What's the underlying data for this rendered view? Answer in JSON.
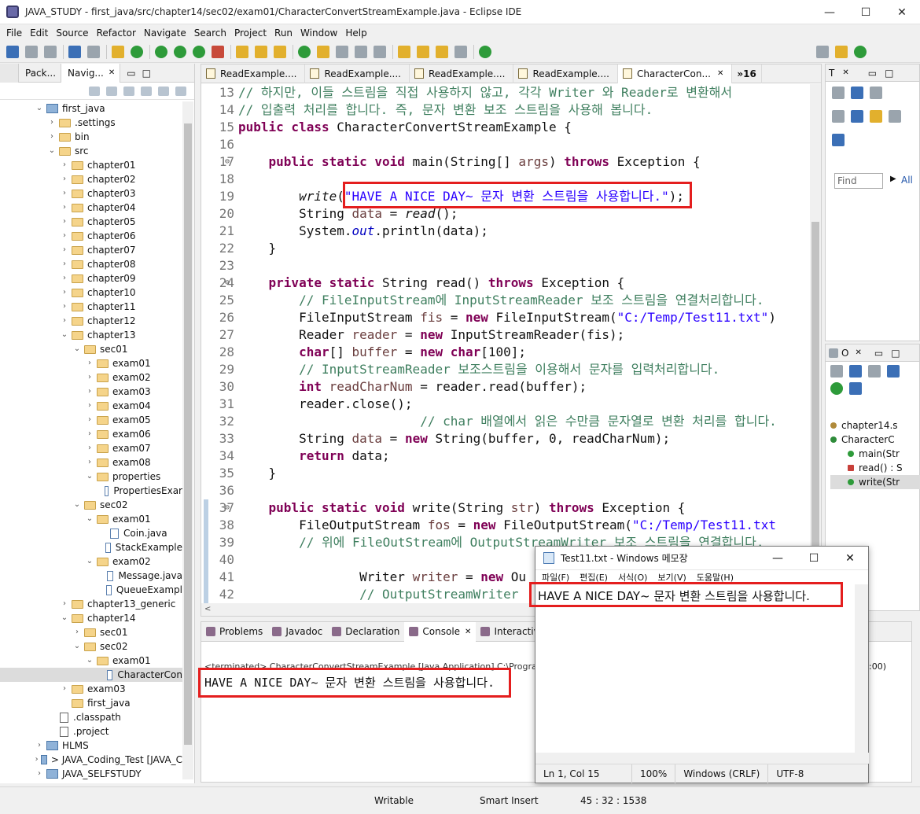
{
  "window": {
    "title": "JAVA_STUDY - first_java/src/chapter14/sec02/exam01/CharacterConvertStreamExample.java - Eclipse IDE",
    "minimize": "—",
    "maximize": "☐",
    "close": "✕"
  },
  "menu": [
    "File",
    "Edit",
    "Source",
    "Refactor",
    "Navigate",
    "Search",
    "Project",
    "Run",
    "Window",
    "Help"
  ],
  "left_panel": {
    "tabs": [
      "Pack...",
      "Navig..."
    ],
    "tree": [
      {
        "label": "first_java",
        "level": 0,
        "kind": "project",
        "open": true
      },
      {
        "label": ".settings",
        "level": 1,
        "kind": "folder",
        "open": false
      },
      {
        "label": "bin",
        "level": 1,
        "kind": "folder",
        "open": false
      },
      {
        "label": "src",
        "level": 1,
        "kind": "folder",
        "open": true
      },
      {
        "label": "chapter01",
        "level": 2,
        "kind": "folder",
        "open": false
      },
      {
        "label": "chapter02",
        "level": 2,
        "kind": "folder",
        "open": false
      },
      {
        "label": "chapter03",
        "level": 2,
        "kind": "folder",
        "open": false
      },
      {
        "label": "chapter04",
        "level": 2,
        "kind": "folder",
        "open": false
      },
      {
        "label": "chapter05",
        "level": 2,
        "kind": "folder",
        "open": false
      },
      {
        "label": "chapter06",
        "level": 2,
        "kind": "folder",
        "open": false
      },
      {
        "label": "chapter07",
        "level": 2,
        "kind": "folder",
        "open": false
      },
      {
        "label": "chapter08",
        "level": 2,
        "kind": "folder",
        "open": false
      },
      {
        "label": "chapter09",
        "level": 2,
        "kind": "folder",
        "open": false
      },
      {
        "label": "chapter10",
        "level": 2,
        "kind": "folder",
        "open": false
      },
      {
        "label": "chapter11",
        "level": 2,
        "kind": "folder",
        "open": false
      },
      {
        "label": "chapter12",
        "level": 2,
        "kind": "folder",
        "open": false
      },
      {
        "label": "chapter13",
        "level": 2,
        "kind": "folder",
        "open": true
      },
      {
        "label": "sec01",
        "level": 3,
        "kind": "folder",
        "open": true
      },
      {
        "label": "exam01",
        "level": 4,
        "kind": "folder",
        "open": false
      },
      {
        "label": "exam02",
        "level": 4,
        "kind": "folder",
        "open": false
      },
      {
        "label": "exam03",
        "level": 4,
        "kind": "folder",
        "open": false
      },
      {
        "label": "exam04",
        "level": 4,
        "kind": "folder",
        "open": false
      },
      {
        "label": "exam05",
        "level": 4,
        "kind": "folder",
        "open": false
      },
      {
        "label": "exam06",
        "level": 4,
        "kind": "folder",
        "open": false
      },
      {
        "label": "exam07",
        "level": 4,
        "kind": "folder",
        "open": false
      },
      {
        "label": "exam08",
        "level": 4,
        "kind": "folder",
        "open": false
      },
      {
        "label": "properties",
        "level": 4,
        "kind": "folder",
        "open": true
      },
      {
        "label": "PropertiesExar",
        "level": 5,
        "kind": "file"
      },
      {
        "label": "sec02",
        "level": 3,
        "kind": "folder",
        "open": true
      },
      {
        "label": "exam01",
        "level": 4,
        "kind": "folder",
        "open": true
      },
      {
        "label": "Coin.java",
        "level": 5,
        "kind": "file"
      },
      {
        "label": "StackExample",
        "level": 5,
        "kind": "file"
      },
      {
        "label": "exam02",
        "level": 4,
        "kind": "folder",
        "open": true
      },
      {
        "label": "Message.java",
        "level": 5,
        "kind": "file"
      },
      {
        "label": "QueueExampl",
        "level": 5,
        "kind": "file"
      },
      {
        "label": "chapter13_generic",
        "level": 2,
        "kind": "folder",
        "open": false
      },
      {
        "label": "chapter14",
        "level": 2,
        "kind": "folder",
        "open": true
      },
      {
        "label": "sec01",
        "level": 3,
        "kind": "folder",
        "open": false
      },
      {
        "label": "sec02",
        "level": 3,
        "kind": "folder",
        "open": true
      },
      {
        "label": "exam01",
        "level": 4,
        "kind": "folder",
        "open": true
      },
      {
        "label": "CharacterCon",
        "level": 5,
        "kind": "file",
        "selected": true
      },
      {
        "label": "exam03",
        "level": 2,
        "kind": "folder",
        "open": false
      },
      {
        "label": "first_java",
        "level": 2,
        "kind": "folder",
        "open": null
      },
      {
        "label": ".classpath",
        "level": 1,
        "kind": "xfile"
      },
      {
        "label": ".project",
        "level": 1,
        "kind": "xfile"
      },
      {
        "label": "HLMS",
        "level": 0,
        "kind": "project",
        "open": false
      },
      {
        "label": "> JAVA_Coding_Test [JAVA_C",
        "level": 0,
        "kind": "project",
        "open": false
      },
      {
        "label": "JAVA_SELFSTUDY",
        "level": 0,
        "kind": "project",
        "open": false
      }
    ]
  },
  "editor": {
    "tabs": [
      "ReadExample....",
      "ReadExample....",
      "ReadExample....",
      "ReadExample....",
      "CharacterCon..."
    ],
    "more_tabs": "»16",
    "lines": [
      {
        "n": "13",
        "segs": [
          [
            "cm",
            "// 하지만, 이들 스트림을 직접 사용하지 않고, 각각 Writer 와 Reader로 변환해서"
          ]
        ]
      },
      {
        "n": "14",
        "segs": [
          [
            "cm",
            "// 입출력 처리를 합니다. 즉, 문자 변환 보조 스트림을 사용해 봅니다."
          ]
        ]
      },
      {
        "n": "15",
        "segs": [
          [
            "kw",
            "public class "
          ],
          [
            "",
            "CharacterConvertStreamExample {"
          ]
        ]
      },
      {
        "n": "16",
        "segs": [
          [
            "",
            ""
          ]
        ]
      },
      {
        "n": "17",
        "mark": true,
        "segs": [
          [
            "",
            "    "
          ],
          [
            "kw",
            "public static void "
          ],
          [
            "",
            "main(String[] "
          ],
          [
            "var",
            "args"
          ],
          [
            "",
            ") "
          ],
          [
            "kw",
            "throws "
          ],
          [
            "",
            "Exception {"
          ]
        ]
      },
      {
        "n": "18",
        "segs": [
          [
            "",
            ""
          ]
        ]
      },
      {
        "n": "19",
        "segs": [
          [
            "",
            "        "
          ],
          [
            "it",
            "write"
          ],
          [
            "",
            "("
          ],
          [
            "st",
            "\"HAVE A NICE DAY~ 문자 변환 스트림을 사용합니다.\""
          ],
          [
            "",
            ");"
          ]
        ]
      },
      {
        "n": "20",
        "segs": [
          [
            "",
            "        String "
          ],
          [
            "var",
            "data"
          ],
          [
            "",
            " = "
          ],
          [
            "it",
            "read"
          ],
          [
            "",
            "();"
          ]
        ]
      },
      {
        "n": "21",
        "segs": [
          [
            "",
            "        System."
          ],
          [
            "fld",
            "out"
          ],
          [
            "",
            ".println(data);"
          ]
        ]
      },
      {
        "n": "22",
        "segs": [
          [
            "",
            "    }"
          ]
        ]
      },
      {
        "n": "23",
        "segs": [
          [
            "",
            ""
          ]
        ]
      },
      {
        "n": "24",
        "mark": true,
        "segs": [
          [
            "",
            "    "
          ],
          [
            "kw",
            "private static "
          ],
          [
            "",
            "String read() "
          ],
          [
            "kw",
            "throws "
          ],
          [
            "",
            "Exception {"
          ]
        ]
      },
      {
        "n": "25",
        "segs": [
          [
            "",
            "        "
          ],
          [
            "cm",
            "// FileInputStream에 InputStreamReader 보조 스트림을 연결처리합니다."
          ]
        ]
      },
      {
        "n": "26",
        "segs": [
          [
            "",
            "        FileInputStream "
          ],
          [
            "var",
            "fis"
          ],
          [
            "",
            " = "
          ],
          [
            "kw",
            "new "
          ],
          [
            "",
            "FileInputStream("
          ],
          [
            "st",
            "\"C:/Temp/Test11.txt\""
          ],
          [
            "",
            ")"
          ]
        ]
      },
      {
        "n": "27",
        "segs": [
          [
            "",
            "        Reader "
          ],
          [
            "var",
            "reader"
          ],
          [
            "",
            " = "
          ],
          [
            "kw",
            "new "
          ],
          [
            "",
            "InputStreamReader(fis);"
          ]
        ]
      },
      {
        "n": "28",
        "segs": [
          [
            "",
            "        "
          ],
          [
            "kw",
            "char"
          ],
          [
            "",
            "[] "
          ],
          [
            "var",
            "buffer"
          ],
          [
            "",
            " = "
          ],
          [
            "kw",
            "new char"
          ],
          [
            "",
            "[100];"
          ]
        ]
      },
      {
        "n": "29",
        "segs": [
          [
            "",
            "        "
          ],
          [
            "cm",
            "// InputStreamReader 보조스트림을 이용해서 문자를 입력처리합니다."
          ]
        ]
      },
      {
        "n": "30",
        "segs": [
          [
            "",
            "        "
          ],
          [
            "kw",
            "int "
          ],
          [
            "var",
            "readCharNum"
          ],
          [
            "",
            " = reader.read(buffer);"
          ]
        ]
      },
      {
        "n": "31",
        "segs": [
          [
            "",
            "        reader.close();"
          ]
        ]
      },
      {
        "n": "32",
        "segs": [
          [
            "",
            "                        "
          ],
          [
            "cm",
            "// char 배열에서 읽은 수만큼 문자열로 변환 처리를 합니다."
          ]
        ]
      },
      {
        "n": "33",
        "segs": [
          [
            "",
            "        String "
          ],
          [
            "var",
            "data"
          ],
          [
            "",
            " = "
          ],
          [
            "kw",
            "new "
          ],
          [
            "",
            "String(buffer, 0, readCharNum);"
          ]
        ]
      },
      {
        "n": "34",
        "segs": [
          [
            "",
            "        "
          ],
          [
            "kw",
            "return "
          ],
          [
            "",
            "data;"
          ]
        ]
      },
      {
        "n": "35",
        "segs": [
          [
            "",
            "    }"
          ]
        ]
      },
      {
        "n": "36",
        "segs": [
          [
            "",
            ""
          ]
        ]
      },
      {
        "n": "37",
        "mark": true,
        "segs": [
          [
            "",
            "    "
          ],
          [
            "kw",
            "public static void "
          ],
          [
            "",
            "write(String "
          ],
          [
            "var",
            "str"
          ],
          [
            "",
            ") "
          ],
          [
            "kw",
            "throws "
          ],
          [
            "",
            "Exception {"
          ]
        ]
      },
      {
        "n": "38",
        "segs": [
          [
            "",
            "        FileOutputStream "
          ],
          [
            "var",
            "fos"
          ],
          [
            "",
            " = "
          ],
          [
            "kw",
            "new "
          ],
          [
            "",
            "FileOutputStream("
          ],
          [
            "st",
            "\"C:/Temp/Test11.txt"
          ]
        ]
      },
      {
        "n": "39",
        "segs": [
          [
            "",
            "        "
          ],
          [
            "cm",
            "// 위에 FileOutStream에 OutputStreamWriter 보조 스트림을 연결합니다."
          ]
        ]
      },
      {
        "n": "40",
        "segs": [
          [
            "",
            ""
          ]
        ]
      },
      {
        "n": "41",
        "segs": [
          [
            "",
            "                Writer "
          ],
          [
            "var",
            "writer"
          ],
          [
            "",
            " = "
          ],
          [
            "kw",
            "new "
          ],
          [
            "",
            "Ou"
          ]
        ]
      },
      {
        "n": "42",
        "segs": [
          [
            "",
            "                "
          ],
          [
            "cm",
            "// OutputStreamWriter"
          ]
        ]
      }
    ]
  },
  "console": {
    "tabs": [
      "Problems",
      "Javadoc",
      "Declaration",
      "Console",
      "Interactive R"
    ],
    "terminated": "<terminated> CharacterConvertStreamExample [Java Application] C:\\Program",
    "terminated_tail": "0:00)",
    "output": "HAVE A NICE DAY~ 문자 변환 스트림을 사용합니다."
  },
  "right_top": {
    "tab": "T",
    "find_placeholder": "Find",
    "all_label": "All"
  },
  "outline": {
    "tab": "O",
    "items": [
      {
        "label": "chapter14.s",
        "level": 0,
        "kind": "package"
      },
      {
        "label": "CharacterC",
        "level": 0,
        "kind": "class"
      },
      {
        "label": "main(Str",
        "level": 1,
        "kind": "public",
        "badge": "S"
      },
      {
        "label": "read() : S",
        "level": 1,
        "kind": "private",
        "badge": "S"
      },
      {
        "label": "write(Str",
        "level": 1,
        "kind": "public",
        "badge": "S",
        "selected": true
      }
    ]
  },
  "notepad": {
    "title": "Test11.txt - Windows 메모장",
    "menu": [
      "파일(F)",
      "편집(E)",
      "서식(O)",
      "보기(V)",
      "도움말(H)"
    ],
    "text": "HAVE A NICE DAY~ 문자 변환 스트림을 사용합니다.",
    "status": {
      "position": "Ln 1, Col 15",
      "zoom": "100%",
      "line_ending": "Windows (CRLF)",
      "encoding": "UTF-8"
    }
  },
  "statusbar": {
    "writable": "Writable",
    "insert_mode": "Smart Insert",
    "cursor": "45 : 32 : 1538"
  },
  "colors": {
    "keyword": "#7f0055",
    "comment": "#3f7f5f",
    "string": "#2a00ff",
    "annotation_red": "#e41e1e"
  }
}
